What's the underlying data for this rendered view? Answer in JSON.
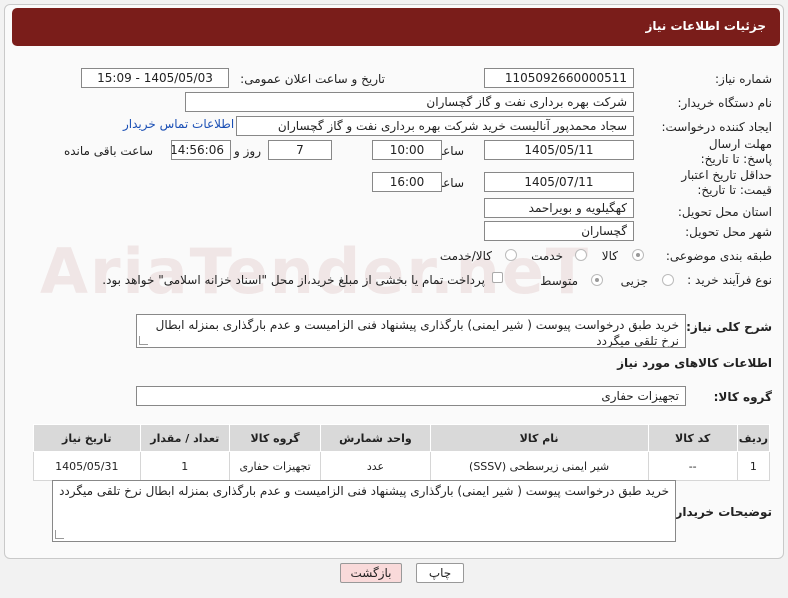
{
  "header": {
    "title": "جزئیات اطلاعات نیاز"
  },
  "labels": {
    "need_number": "شماره نیاز:",
    "announce_datetime": "تاریخ و ساعت اعلان عمومی:",
    "buyer_org": "نام دستگاه خریدار:",
    "requester": "ایجاد کننده درخواست:",
    "reply_deadline": "مهلت ارسال پاسخ: تا تاریخ:",
    "time": "ساعت",
    "day_and": "روز و",
    "time_remaining": "ساعت باقی مانده",
    "price_validity": "حداقل تاریخ اعتبار قیمت: تا تاریخ:",
    "delivery_province": "استان محل تحویل:",
    "delivery_city": "شهر محل تحویل:",
    "category": "طبقه بندی موضوعی:",
    "purchase_process": "نوع فرآیند خرید :",
    "general_desc": "شرح کلی نیاز:",
    "goods_info": "اطلاعات کالاهای مورد نیاز",
    "goods_group": "گروه کالا:",
    "buyer_notes": "توضیحات خریدار:"
  },
  "fields": {
    "need_number": "1105092660000511",
    "announce_datetime": "1405/05/03 - 15:09",
    "buyer_org": "شرکت بهره برداری نفت و گاز گچساران",
    "requester": "سجاد محمدپور آنالیست خرید شرکت بهره برداری نفت و گاز گچساران",
    "contact_link": "اطلاعات تماس خریدار",
    "reply_date": "1405/05/11",
    "reply_time": "10:00",
    "reply_days": "7",
    "remaining_time": "14:56:06",
    "validity_date": "1405/07/11",
    "validity_time": "16:00",
    "province": "کهگیلویه و بویراحمد",
    "city": "گچساران",
    "goods_group": "تجهیزات حفاری"
  },
  "category_options": {
    "goods": "کالا",
    "service": "خدمت",
    "goods_service": "کالا/خدمت"
  },
  "process_options": {
    "minor": "جزیی",
    "medium": "متوسط"
  },
  "payment_note": "پرداخت تمام یا بخشی از مبلغ خرید،از محل \"اسناد خزانه اسلامی\" خواهد بود.",
  "general_description": "خرید طبق درخواست پیوست ( شیر ایمنی) بارگذاری پیشنهاد فنی الزامیست و عدم بارگذاری بمنزله ابطال نرخ تلقی میگردد",
  "table": {
    "headers": [
      "ردیف",
      "کد کالا",
      "نام کالا",
      "واحد شمارش",
      "گروه کالا",
      "تعداد / مقدار",
      "تاریخ نیاز"
    ],
    "rows": [
      [
        "1",
        "--",
        "شیر ایمنی زیرسطحی (SSSV)",
        "عدد",
        "تجهیزات حفاری",
        "1",
        "1405/05/31"
      ]
    ]
  },
  "buyer_notes": "خرید طبق درخواست پیوست ( شیر ایمنی) بارگذاری پیشنهاد فنی الزامیست و عدم بارگذاری بمنزله ابطال نرخ تلقی میگردد",
  "buttons": {
    "print": "چاپ",
    "back": "بازگشت"
  },
  "watermark": "AriaTender.neT",
  "colors": {
    "header_bg": "#7a1d1a",
    "link": "#1a4fb5",
    "back_btn_bg": "#f9dada"
  }
}
